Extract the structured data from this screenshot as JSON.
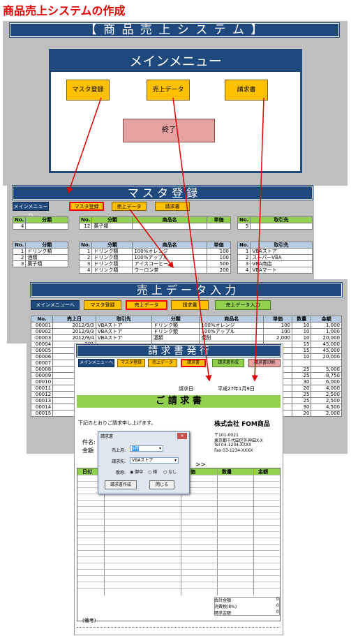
{
  "page_title": "商品売上システムの作成",
  "main_menu": {
    "banner": "【 商 品 売 上 シ ス テ ム 】",
    "title": "メインメニュー",
    "buttons": [
      "マスタ登録",
      "売上データ",
      "請求書"
    ],
    "exit": "終了"
  },
  "master": {
    "banner": "マ ス タ 登 録",
    "nav": [
      "メインメニューへ",
      "マスタ登録",
      "売上データ",
      "請求書"
    ],
    "cat_input": {
      "headers": [
        "No.",
        "分類"
      ],
      "row": [
        "4",
        ""
      ]
    },
    "prod_input": {
      "headers": [
        "No.",
        "分類",
        "商品名",
        "単価"
      ],
      "row": [
        "12",
        "菓子類",
        "",
        ""
      ]
    },
    "cust_input": {
      "headers": [
        "No.",
        "取引先"
      ],
      "row": [
        "5",
        ""
      ]
    },
    "cat_list": {
      "headers": [
        "No.",
        "分類"
      ],
      "rows": [
        [
          "1",
          "ドリンク類"
        ],
        [
          "2",
          "酒類"
        ],
        [
          "3",
          "菓子類"
        ]
      ]
    },
    "prod_list": {
      "headers": [
        "No.",
        "分類",
        "商品名",
        "単価"
      ],
      "rows": [
        [
          "1",
          "ドリンク類",
          "100%オレンジ",
          "100"
        ],
        [
          "2",
          "ドリンク類",
          "100%アップル",
          "100"
        ],
        [
          "3",
          "ドリンク類",
          "アイスコーヒー",
          "500"
        ],
        [
          "4",
          "ドリンク類",
          "ウーロン茶",
          "200"
        ]
      ]
    },
    "cust_list": {
      "headers": [
        "No.",
        "取引先"
      ],
      "rows": [
        [
          "1",
          "VBAストア"
        ],
        [
          "2",
          "スーパーVBA"
        ],
        [
          "3",
          "VBA商店"
        ],
        [
          "4",
          "VBAマート"
        ]
      ]
    }
  },
  "sales": {
    "banner": "売 上 デ ー タ 入 力",
    "nav": [
      "メインメニューへ",
      "マスタ登録",
      "売上データ",
      "請求書",
      "売上データ入力"
    ],
    "headers": [
      "No.",
      "売上日",
      "取引先",
      "分類",
      "商品名",
      "単価",
      "数量",
      "金額"
    ],
    "rows": [
      [
        "00001",
        "2012/9/3",
        "VBAストア",
        "ドリンク類",
        "100%オレンジ",
        "100",
        "10",
        "1,000"
      ],
      [
        "00002",
        "2012/9/3",
        "VBAストア",
        "ドリンク類",
        "100%アップル",
        "100",
        "10",
        "1,000"
      ],
      [
        "00003",
        "2012/9/4",
        "VBAストア",
        "酒類",
        "焼酎",
        "2,000",
        "10",
        "20,000"
      ],
      [
        "00004",
        "201",
        "",
        "",
        "",
        "",
        "15",
        "45,000"
      ],
      [
        "00005",
        "201",
        "",
        "",
        "",
        "",
        "15",
        "45,000"
      ],
      [
        "00006",
        "201",
        "",
        "",
        "",
        "",
        "10",
        "20,000"
      ],
      [
        "00007",
        "2012",
        "",
        "",
        "",
        "",
        "",
        ""
      ],
      [
        "00008",
        "2012",
        "",
        "",
        "",
        "",
        "25",
        "5,000"
      ],
      [
        "00009",
        "2012",
        "",
        "",
        "",
        "",
        "25",
        "8,750"
      ],
      [
        "00010",
        "2012",
        "",
        "",
        "",
        "",
        "30",
        "6,000"
      ],
      [
        "00011",
        "2012",
        "",
        "",
        "",
        "",
        "20",
        "4,000"
      ],
      [
        "00012",
        "2012",
        "",
        "",
        "",
        "",
        "25",
        "2,500"
      ],
      [
        "00013",
        "2012",
        "",
        "",
        "",
        "",
        "25",
        "2,500"
      ],
      [
        "00014",
        "2012",
        "",
        "",
        "",
        "",
        "30",
        "4,500"
      ],
      [
        "00015",
        "2012",
        "",
        "",
        "",
        "",
        "20",
        "2,000"
      ]
    ]
  },
  "invoice": {
    "banner": "請 求 書 発 行",
    "nav": [
      "メインメニューへ",
      "マスタ登録",
      "売上データ",
      "請求書",
      "請求書作成",
      "請求書印刷"
    ],
    "date_label": "請求日:",
    "date_value": "平成27年1月9日",
    "title": "ご 請 求 書",
    "greeting": "下記のとおりご請求申し上げます。",
    "company": "株式会社 FOM商品",
    "address": [
      "〒101-0021",
      "東京都千代田区外神田X-X",
      "Tel 03-1234-XXXX",
      "Fax 03-1234-XXXX"
    ],
    "subject_label": "件名:",
    "amount_label": "金額",
    "period_suffix": ">>",
    "table_headers": [
      "日付",
      "単価",
      "数量",
      "金額"
    ],
    "totals": [
      [
        "合計金額",
        "0"
      ],
      [
        "消費税(8%)",
        "0"
      ],
      [
        "請求金額",
        "0"
      ]
    ],
    "remarks_label": "(備考)"
  },
  "dialog": {
    "title": "請求書",
    "month_label": "売上月:",
    "month_value": "9月",
    "customer_label": "請求先:",
    "customer_value": "VBAストア",
    "honorific_label": "敬称:",
    "honorific_options": [
      "御中",
      "様",
      "なし"
    ],
    "create_btn": "請求書作成",
    "close_btn": "閉じる",
    "close_x": "✕"
  },
  "colors": {
    "banner": "#1f497d",
    "button": "#ffc000",
    "accent_green": "#92d050",
    "arrow": "#e00000",
    "header_blue": "#b8cce4"
  }
}
